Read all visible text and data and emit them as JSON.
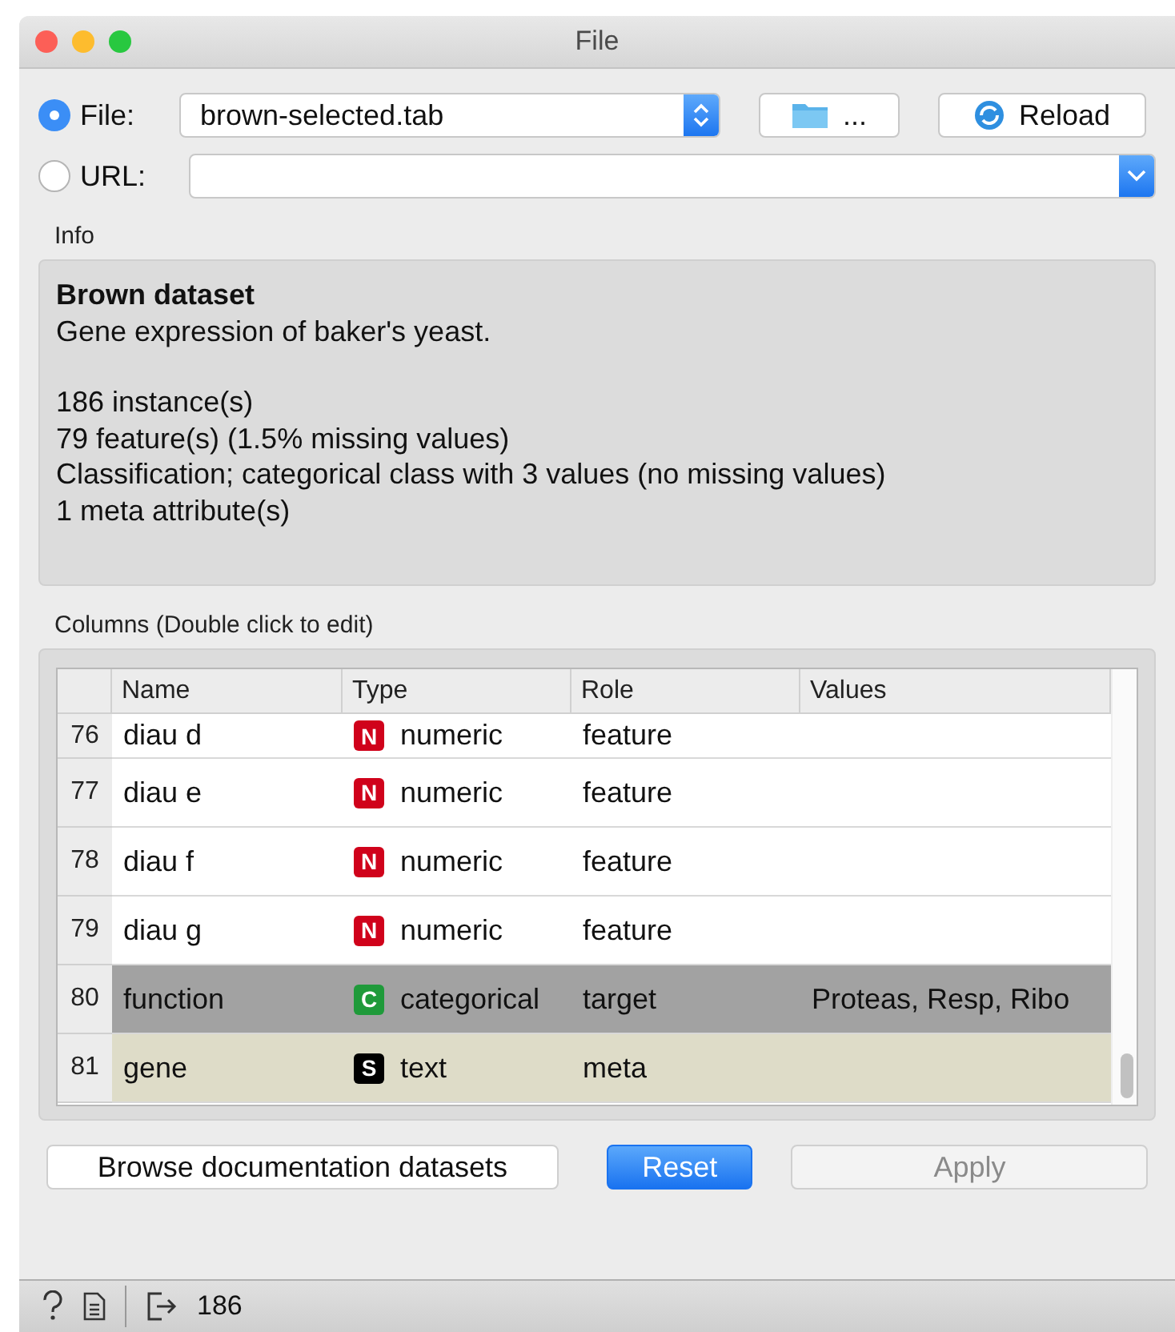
{
  "window": {
    "title": "File"
  },
  "source": {
    "options": [
      {
        "label": "File:",
        "selected": true
      },
      {
        "label": "URL:",
        "selected": false
      }
    ],
    "file": "brown-selected.tab",
    "browse_label": "...",
    "reload_label": "Reload"
  },
  "info": {
    "heading": "Info",
    "title": "Brown dataset",
    "description": "Gene expression of baker's yeast.",
    "lines": [
      "186 instance(s)",
      "79 feature(s) (1.5% missing values)",
      "Classification; categorical class with 3 values (no missing values)",
      "1 meta attribute(s)"
    ]
  },
  "columns": {
    "heading": "Columns (Double click to edit)",
    "headers": [
      "Name",
      "Type",
      "Role",
      "Values"
    ],
    "rows": [
      {
        "index": "76",
        "name": "diau d",
        "badge": "N",
        "color": "#d0021b",
        "type": "numeric",
        "role": "feature",
        "values": "",
        "kind": "feature"
      },
      {
        "index": "77",
        "name": "diau e",
        "badge": "N",
        "color": "#d0021b",
        "type": "numeric",
        "role": "feature",
        "values": "",
        "kind": "feature"
      },
      {
        "index": "78",
        "name": "diau f",
        "badge": "N",
        "color": "#d0021b",
        "type": "numeric",
        "role": "feature",
        "values": "",
        "kind": "feature"
      },
      {
        "index": "79",
        "name": "diau g",
        "badge": "N",
        "color": "#d0021b",
        "type": "numeric",
        "role": "feature",
        "values": "",
        "kind": "feature"
      },
      {
        "index": "80",
        "name": "function",
        "badge": "C",
        "color": "#1f9a3a",
        "type": "categorical",
        "role": "target",
        "values": "Proteas, Resp, Ribo",
        "kind": "target"
      },
      {
        "index": "81",
        "name": "gene",
        "badge": "S",
        "color": "#000000",
        "type": "text",
        "role": "meta",
        "values": "",
        "kind": "meta"
      }
    ]
  },
  "buttons": [
    {
      "label": "Browse documentation datasets",
      "kind": "normal"
    },
    {
      "label": "Reset",
      "kind": "default"
    },
    {
      "label": "Apply",
      "kind": "disabled"
    }
  ],
  "status_bar": {
    "output_count": "186"
  }
}
